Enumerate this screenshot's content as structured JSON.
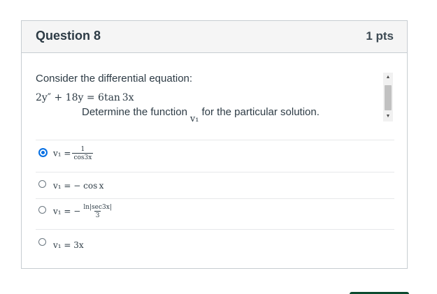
{
  "question": {
    "title": "Question 8",
    "points": "1 pts",
    "prompt": "Consider the differential equation:",
    "equation": "2y″ + 18y = 6tan 3x",
    "determine_before": "Determine the function",
    "determine_var": "v₁",
    "determine_after": "for the particular solution."
  },
  "options": [
    {
      "lhs": "v₁ =",
      "num": "1",
      "den": "cos3x",
      "selected": true
    },
    {
      "text": "v₁ = − cos x",
      "selected": false
    },
    {
      "lhs": "v₁ = −",
      "num": "ln|sec3x|",
      "den": "3",
      "selected": false
    },
    {
      "text": "v₁ = 3x",
      "selected": false
    }
  ],
  "colors": {
    "accent": "#0770e3",
    "header_bg": "#f5f5f5",
    "border": "#c7cdd1"
  },
  "icons": {
    "scroll_up": "triangle-up-icon",
    "scroll_down": "triangle-down-icon"
  }
}
